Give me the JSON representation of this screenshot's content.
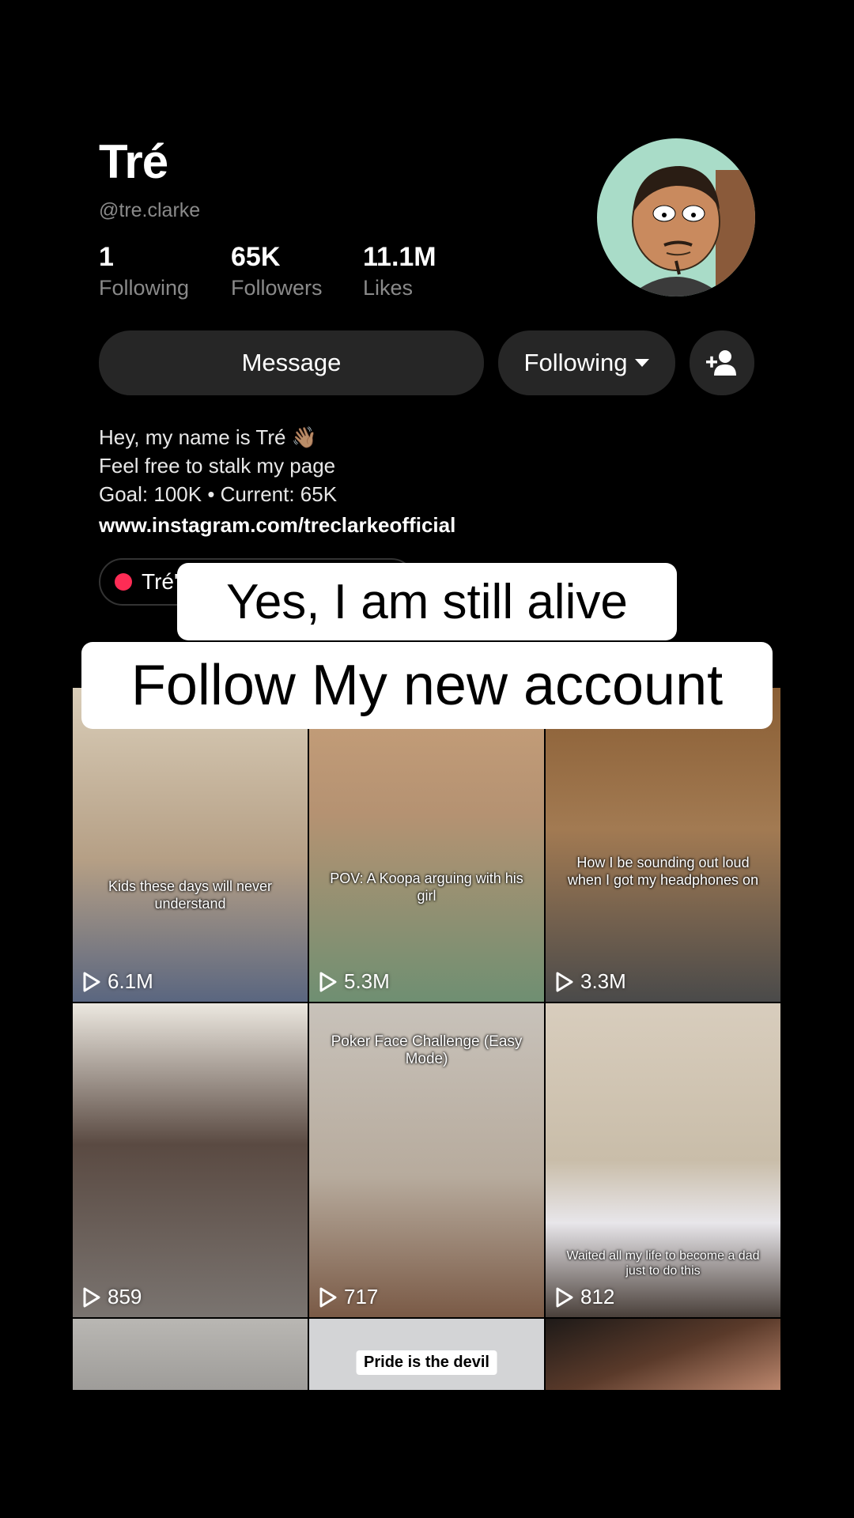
{
  "profile": {
    "name": "Tré",
    "handle": "@tre.clarke",
    "stats": [
      {
        "value": "1",
        "label": "Following"
      },
      {
        "value": "65K",
        "label": "Followers"
      },
      {
        "value": "11.1M",
        "label": "Likes"
      }
    ]
  },
  "actions": {
    "message_label": "Message",
    "following_label": "Following",
    "add_friend_icon": "person-add-icon"
  },
  "bio": {
    "line1": "Hey, my name is Tré 👋🏽",
    "line2": "Feel free to stalk my page",
    "line3": "Goal: 100K • Current: 65K",
    "link": "www.instagram.com/treclarkeofficial"
  },
  "chip": {
    "label": "Tré'"
  },
  "overlay": {
    "caption1": "Yes, I am still alive",
    "caption2": "Follow My new account"
  },
  "videos": [
    {
      "caption": "Kids these days will never understand",
      "views": "6.1M",
      "bg": "#b8a48c"
    },
    {
      "caption": "POV: A Koopa arguing with his girl",
      "views": "5.3M",
      "bg": "#9c8a74"
    },
    {
      "caption": "How I be sounding out loud when I got my headphones on",
      "views": "3.3M",
      "bg": "#7a5a3a"
    },
    {
      "caption": "",
      "views": "859",
      "bg": "#5e5550"
    },
    {
      "caption": "Poker Face Challenge (Easy Mode)",
      "views": "717",
      "bg": "#b9b3ab"
    },
    {
      "caption": "Waited all my life to become a dad just to do this",
      "views": "812",
      "bg": "#c9bca9"
    },
    {
      "caption": "",
      "views": "",
      "bg": "#a9a8a5"
    },
    {
      "caption": "Pride is the devil",
      "views": "",
      "bg": "#cfd0d2"
    },
    {
      "caption": "",
      "views": "",
      "bg": "#3a2c24"
    }
  ],
  "colors": {
    "background": "#000000",
    "button": "#262626",
    "accent": "#fe2c55"
  }
}
